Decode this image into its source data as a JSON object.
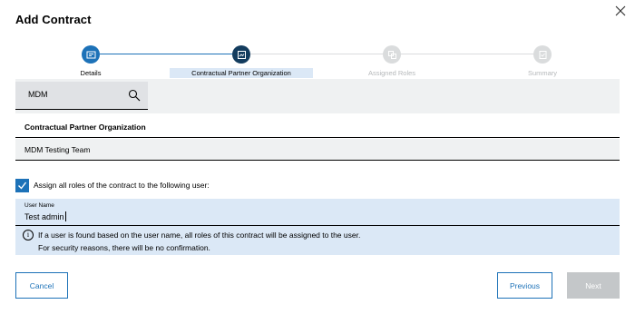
{
  "dialog": {
    "title": "Add Contract"
  },
  "stepper": {
    "steps": [
      {
        "label": "Details",
        "state": "done"
      },
      {
        "label": "Contractual Partner Organization",
        "state": "active"
      },
      {
        "label": "Assigned Roles",
        "state": "inactive"
      },
      {
        "label": "Summary",
        "state": "inactive"
      }
    ]
  },
  "search": {
    "value": "MDM"
  },
  "org_section": {
    "heading": "Contractual Partner Organization",
    "selected": "MDM Testing Team"
  },
  "assign": {
    "checked": true,
    "label": "Assign all roles of the contract to the following user:",
    "field_label": "User Name",
    "field_value": "Test admin",
    "info_line1": "If a user is found based on the user name, all roles of this contract will be assigned to the user.",
    "info_line2": "For security reasons, there will be no confirmation."
  },
  "buttons": {
    "cancel": "Cancel",
    "previous": "Previous",
    "next": "Next"
  },
  "colors": {
    "primary": "#1d72b8",
    "active_step": "#133c5e",
    "highlight": "#dbe8f6",
    "disabled": "#c4c7c9"
  }
}
